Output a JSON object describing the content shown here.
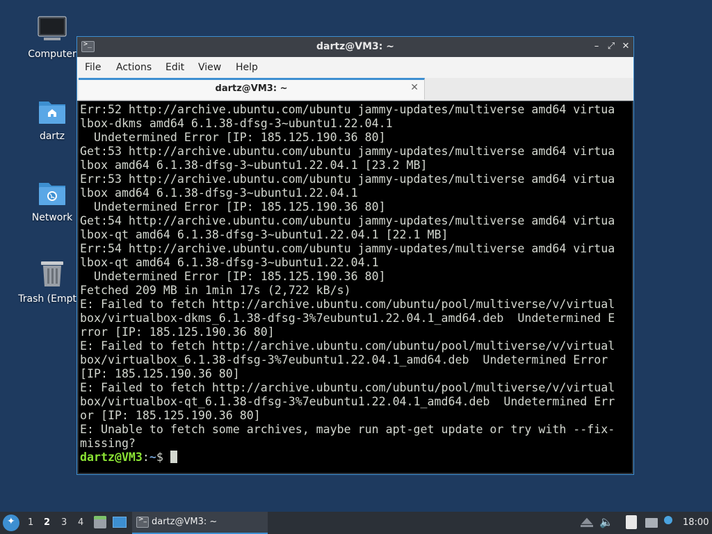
{
  "desktop": {
    "icons": [
      {
        "label": "Computer",
        "icon": "monitor-icon"
      },
      {
        "label": "dartz",
        "icon": "home-folder-icon"
      },
      {
        "label": "Network",
        "icon": "network-folder-icon"
      },
      {
        "label": "Trash (Empty)",
        "icon": "trash-icon"
      }
    ]
  },
  "window": {
    "title": "dartz@VM3: ~",
    "controls": {
      "minimize": "–",
      "maximize": "⤢",
      "close": "✕"
    },
    "menu": [
      "File",
      "Actions",
      "Edit",
      "View",
      "Help"
    ],
    "tab": {
      "label": "dartz@VM3: ~",
      "close": "✕"
    },
    "terminal": {
      "lines": [
        "Err:52 http://archive.ubuntu.com/ubuntu jammy-updates/multiverse amd64 virtua",
        "lbox-dkms amd64 6.1.38-dfsg-3~ubuntu1.22.04.1",
        "  Undetermined Error [IP: 185.125.190.36 80]",
        "Get:53 http://archive.ubuntu.com/ubuntu jammy-updates/multiverse amd64 virtua",
        "lbox amd64 6.1.38-dfsg-3~ubuntu1.22.04.1 [23.2 MB]",
        "Err:53 http://archive.ubuntu.com/ubuntu jammy-updates/multiverse amd64 virtua",
        "lbox amd64 6.1.38-dfsg-3~ubuntu1.22.04.1",
        "  Undetermined Error [IP: 185.125.190.36 80]",
        "Get:54 http://archive.ubuntu.com/ubuntu jammy-updates/multiverse amd64 virtua",
        "lbox-qt amd64 6.1.38-dfsg-3~ubuntu1.22.04.1 [22.1 MB]",
        "Err:54 http://archive.ubuntu.com/ubuntu jammy-updates/multiverse amd64 virtua",
        "lbox-qt amd64 6.1.38-dfsg-3~ubuntu1.22.04.1",
        "  Undetermined Error [IP: 185.125.190.36 80]",
        "Fetched 209 MB in 1min 17s (2,722 kB/s)",
        "E: Failed to fetch http://archive.ubuntu.com/ubuntu/pool/multiverse/v/virtual",
        "box/virtualbox-dkms_6.1.38-dfsg-3%7eubuntu1.22.04.1_amd64.deb  Undetermined E",
        "rror [IP: 185.125.190.36 80]",
        "E: Failed to fetch http://archive.ubuntu.com/ubuntu/pool/multiverse/v/virtual",
        "box/virtualbox_6.1.38-dfsg-3%7eubuntu1.22.04.1_amd64.deb  Undetermined Error",
        "[IP: 185.125.190.36 80]",
        "E: Failed to fetch http://archive.ubuntu.com/ubuntu/pool/multiverse/v/virtual",
        "box/virtualbox-qt_6.1.38-dfsg-3%7eubuntu1.22.04.1_amd64.deb  Undetermined Err",
        "or [IP: 185.125.190.36 80]",
        "E: Unable to fetch some archives, maybe run apt-get update or try with --fix-",
        "missing?"
      ],
      "prompt": {
        "user_host": "dartz@VM3",
        "separator": ":",
        "path": "~",
        "symbol": "$ "
      }
    }
  },
  "taskbar": {
    "workspaces": [
      "1",
      "2",
      "3",
      "4"
    ],
    "active_workspace": "2",
    "tasks": [
      {
        "label": "dartz@VM3: ~",
        "icon": "terminal-icon"
      }
    ],
    "clock": "18:00"
  },
  "colors": {
    "desktop_bg": "#1e3a5f",
    "accent": "#3d8fd1",
    "prompt_user": "#8ae234",
    "prompt_path": "#729fcf"
  }
}
